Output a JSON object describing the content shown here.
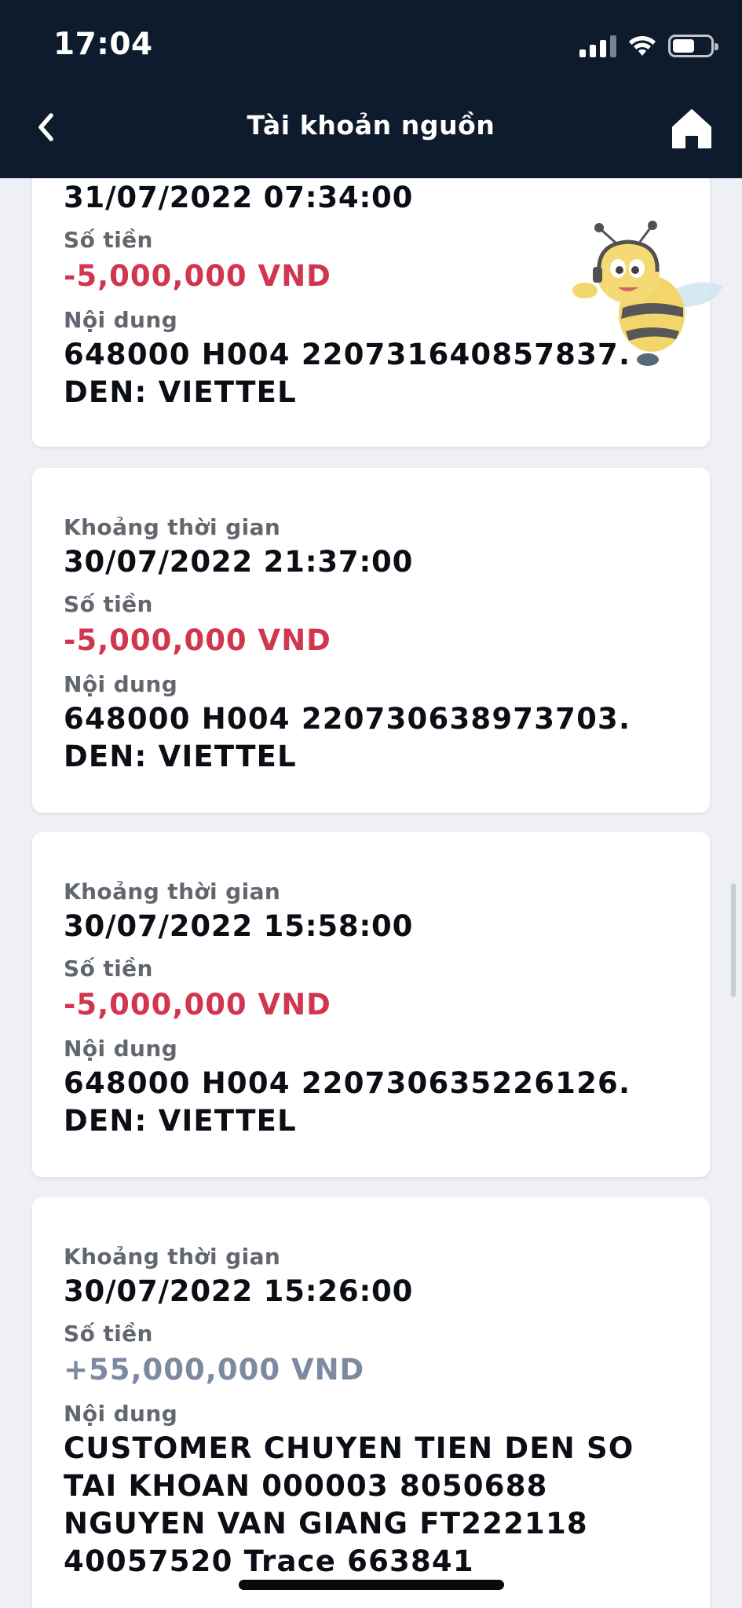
{
  "status_bar": {
    "time": "17:04"
  },
  "nav": {
    "title": "Tài khoản nguồn"
  },
  "labels": {
    "time": "Khoảng thời gian",
    "amount": "Số tiền",
    "content": "Nội dung"
  },
  "colors": {
    "header_bg": "#0e1b2c",
    "negative": "#d2364f",
    "positive": "#7b8aa0"
  },
  "icons": {
    "back": "chevron-left-icon",
    "home": "home-icon",
    "mascot": "bee-mascot"
  },
  "transactions": [
    {
      "time": "31/07/2022 07:34:00",
      "amount": "-5,000,000 VND",
      "content": "648000 H004 220731640857837. DEN: VIETTEL"
    },
    {
      "time": "30/07/2022 21:37:00",
      "amount": "-5,000,000 VND",
      "content": "648000 H004 220730638973703. DEN: VIETTEL"
    },
    {
      "time": "30/07/2022 15:58:00",
      "amount": "-5,000,000 VND",
      "content": "648000 H004 220730635226126. DEN: VIETTEL"
    },
    {
      "time": "30/07/2022 15:26:00",
      "amount": "+55,000,000 VND",
      "content": "CUSTOMER CHUYEN TIEN DEN SO TAI KHOAN 000003 8050688   NGUYEN VAN GIANG FT222118 40057520 Trace 663841"
    }
  ]
}
